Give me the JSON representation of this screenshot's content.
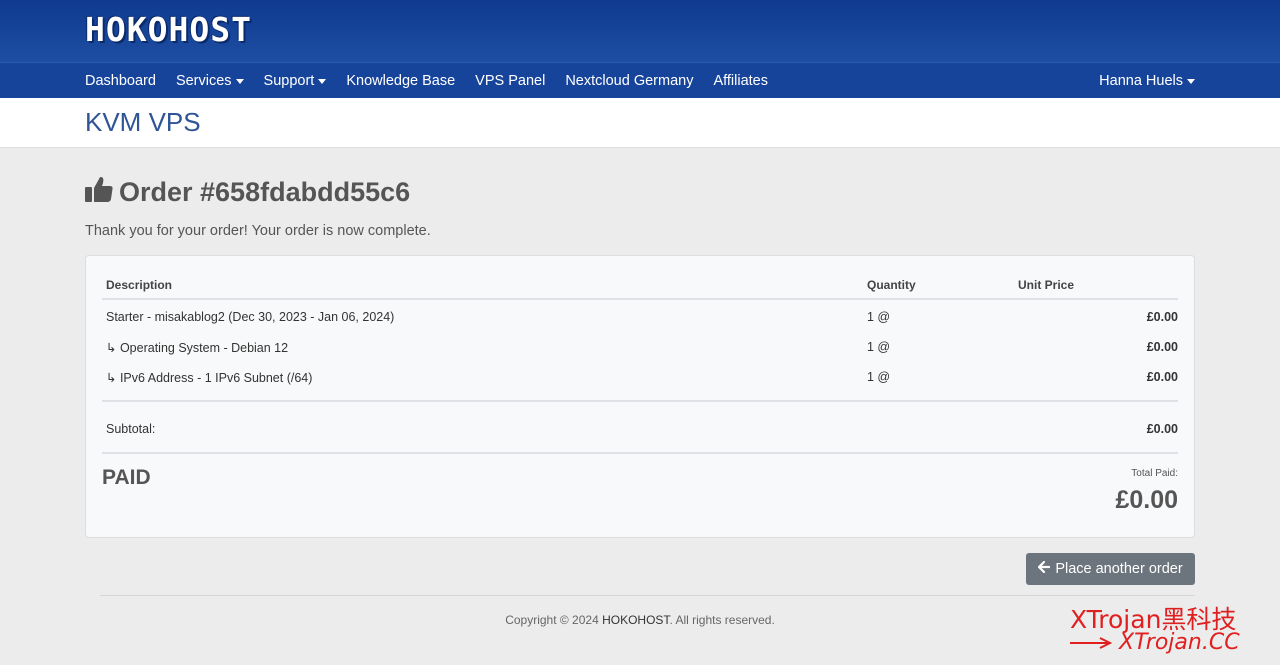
{
  "brand": {
    "logo": "HOKOHOST"
  },
  "nav": {
    "items": [
      {
        "label": "Dashboard",
        "dropdown": false
      },
      {
        "label": "Services",
        "dropdown": true
      },
      {
        "label": "Support",
        "dropdown": true
      },
      {
        "label": "Knowledge Base",
        "dropdown": false
      },
      {
        "label": "VPS Panel",
        "dropdown": false
      },
      {
        "label": "Nextcloud Germany",
        "dropdown": false
      },
      {
        "label": "Affiliates",
        "dropdown": false
      }
    ],
    "user": "Hanna Huels"
  },
  "page": {
    "title": "KVM VPS"
  },
  "order": {
    "title": "Order #658fdabdd55c6",
    "message": "Thank you for your order! Your order is now complete.",
    "table": {
      "headers": {
        "description": "Description",
        "quantity": "Quantity",
        "unit_price": "Unit Price"
      },
      "rows": [
        {
          "description": "Starter - misakablog2 (Dec 30, 2023 - Jan 06, 2024)",
          "quantity": "1 @",
          "price": "£0.00"
        },
        {
          "description": "↳ Operating System - Debian 12",
          "quantity": "1 @",
          "price": "£0.00"
        },
        {
          "description": "↳ IPv6 Address - 1 IPv6 Subnet (/64)",
          "quantity": "1 @",
          "price": "£0.00"
        }
      ],
      "subtotal_label": "Subtotal:",
      "subtotal_value": "£0.00"
    },
    "status": "PAID",
    "total_label": "Total Paid:",
    "total_value": "£0.00"
  },
  "actions": {
    "place_another_order": "Place another order"
  },
  "footer": {
    "prefix": "Copyright © 2024 ",
    "brand": "HOKOHOST",
    "suffix": ". All rights reserved."
  },
  "watermark": {
    "line1": "XTrojan黑科技",
    "line2": "XTrojan.CC"
  },
  "colors": {
    "header": "#17449b",
    "accent": "#2f5597",
    "button": "#6c757d"
  }
}
